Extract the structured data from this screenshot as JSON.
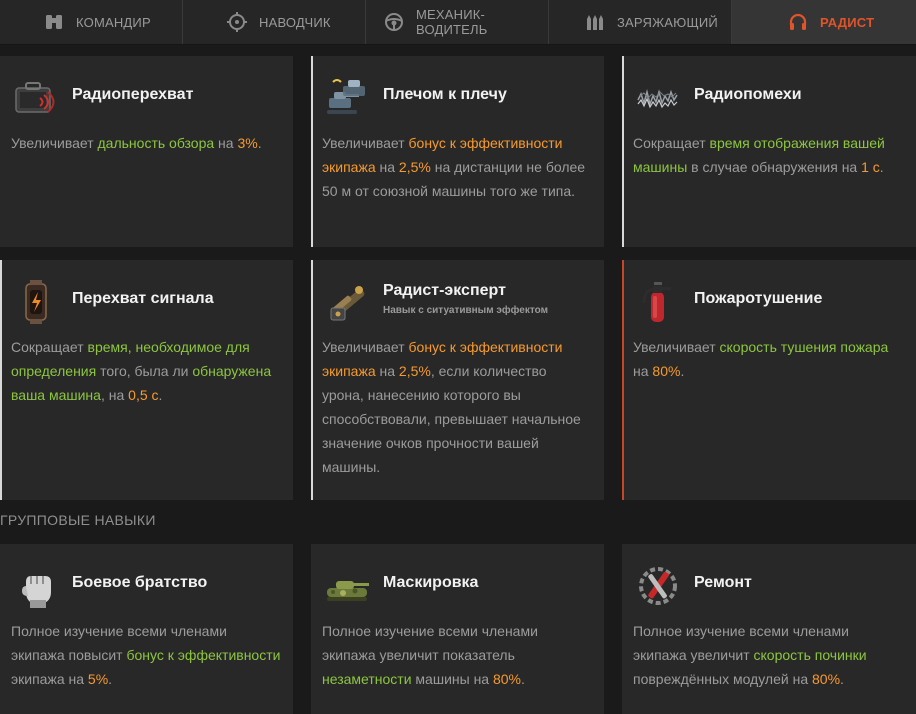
{
  "tabs": [
    {
      "label": "КОМАНДИР",
      "icon": "binoculars-icon",
      "active": false
    },
    {
      "label": "НАВОДЧИК",
      "icon": "crosshair-icon",
      "active": false
    },
    {
      "label": "МЕХАНИК-ВОДИТЕЛЬ",
      "icon": "steering-wheel-icon",
      "active": false
    },
    {
      "label": "ЗАРЯЖАЮЩИЙ",
      "icon": "shells-icon",
      "active": false
    },
    {
      "label": "РАДИСТ",
      "icon": "headphones-icon",
      "active": true
    }
  ],
  "colors": {
    "accent": "#e0542a",
    "green": "#8cc63f",
    "orange": "#f79a2e"
  },
  "skills": [
    {
      "title": "Радиоперехват",
      "icon": "radio-case-icon",
      "desc": [
        [
          "Увеличивает ",
          "n"
        ],
        [
          "дальность обзора",
          "g"
        ],
        [
          " на ",
          "n"
        ],
        [
          "3%",
          "o"
        ],
        [
          ".",
          "n"
        ]
      ]
    },
    {
      "title": "Плечом к плечу",
      "icon": "tanks-together-icon",
      "desc": [
        [
          "Увеличивает ",
          "n"
        ],
        [
          "бонус к эффективности экипажа",
          "o"
        ],
        [
          " на ",
          "n"
        ],
        [
          "2,5%",
          "o"
        ],
        [
          " на дистанции не более 50 м от союзной машины того же типа.",
          "n"
        ]
      ]
    },
    {
      "title": "Радиопомехи",
      "icon": "radio-noise-icon",
      "desc": [
        [
          "Сокращает ",
          "n"
        ],
        [
          "время отображения вашей машины",
          "g"
        ],
        [
          " в случае обнаружения на ",
          "n"
        ],
        [
          "1 с",
          "o"
        ],
        [
          ".",
          "n"
        ]
      ]
    },
    {
      "title": "Перехват сигнала",
      "icon": "signal-lamp-icon",
      "desc": [
        [
          "Сокращает ",
          "n"
        ],
        [
          "время, необходимое для определения",
          "g"
        ],
        [
          " того, была ли ",
          "n"
        ],
        [
          "обнаружена ваша машина",
          "g"
        ],
        [
          ", на ",
          "n"
        ],
        [
          "0,5 с",
          "o"
        ],
        [
          ".",
          "n"
        ]
      ]
    },
    {
      "title": "Радист-эксперт",
      "subtitle": "Навык с ситуативным эффектом",
      "icon": "radio-tools-icon",
      "desc": [
        [
          "Увеличивает ",
          "n"
        ],
        [
          "бонус к эффективности экипажа",
          "o"
        ],
        [
          " на ",
          "n"
        ],
        [
          "2,5%",
          "o"
        ],
        [
          ", если количество урона, нанесению которого вы способствовали, превышает начальное значение очков прочности вашей машины.",
          "n"
        ]
      ]
    },
    {
      "title": "Пожаротушение",
      "icon": "fire-extinguisher-icon",
      "desc": [
        [
          "Увеличивает ",
          "n"
        ],
        [
          "скорость тушения пожара",
          "g"
        ],
        [
          " на ",
          "n"
        ],
        [
          "80%",
          "o"
        ],
        [
          ".",
          "n"
        ]
      ]
    }
  ],
  "group_section_title": "ГРУППОВЫЕ НАВЫКИ",
  "group_skills": [
    {
      "title": "Боевое братство",
      "icon": "fist-icon",
      "desc": [
        [
          "Полное изучение всеми членами экипажа повысит ",
          "n"
        ],
        [
          "бонус к эффективности",
          "g"
        ],
        [
          " экипажа на ",
          "n"
        ],
        [
          "5%",
          "o"
        ],
        [
          ".",
          "n"
        ]
      ]
    },
    {
      "title": "Маскировка",
      "icon": "camo-tank-icon",
      "desc": [
        [
          "Полное изучение всеми членами экипажа увеличит показатель ",
          "n"
        ],
        [
          "незаметности",
          "g"
        ],
        [
          " машины на ",
          "n"
        ],
        [
          "80%",
          "o"
        ],
        [
          ".",
          "n"
        ]
      ]
    },
    {
      "title": "Ремонт",
      "icon": "wrench-icon",
      "desc": [
        [
          "Полное изучение всеми членами экипажа увеличит ",
          "n"
        ],
        [
          "скорость починки",
          "g"
        ],
        [
          " повреждённых модулей на ",
          "n"
        ],
        [
          "80%",
          "o"
        ],
        [
          ".",
          "n"
        ]
      ]
    }
  ]
}
